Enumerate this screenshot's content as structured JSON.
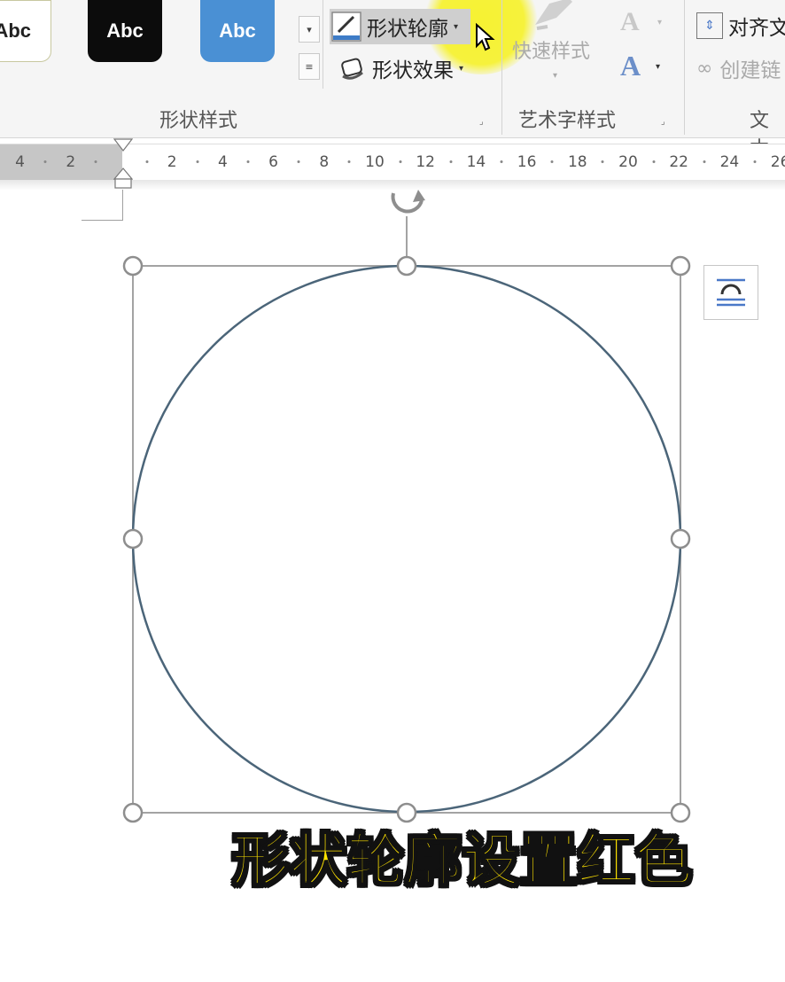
{
  "ribbon": {
    "shape_styles": {
      "presets": [
        {
          "label": "Abc",
          "fill": "#ffffff",
          "text_color": "#222222"
        },
        {
          "label": "Abc",
          "fill": "#0c0c0c",
          "text_color": "#ffffff"
        },
        {
          "label": "Abc",
          "fill": "#4a90d4",
          "text_color": "#ffffff"
        }
      ],
      "shape_outline_label": "形状轮廓",
      "shape_effects_label": "形状效果",
      "group_label": "形状样式"
    },
    "wordart_styles": {
      "quick_styles_label": "快速样式",
      "group_label": "艺术字样式"
    },
    "text": {
      "align_text_label": "对齐文",
      "create_link_label": "创建链",
      "group_label": "文本"
    }
  },
  "ruler": {
    "left_labels": [
      "4",
      "2"
    ],
    "labels": [
      "2",
      "4",
      "6",
      "8",
      "10",
      "12",
      "14",
      "16",
      "18",
      "20",
      "22",
      "24",
      "26"
    ]
  },
  "colors": {
    "shape_outline": "#4b6579",
    "highlight": "#f6f228",
    "caption_text": "#ffe300",
    "caption_stroke": "#111111"
  },
  "caption": "形状轮廓设置红色"
}
